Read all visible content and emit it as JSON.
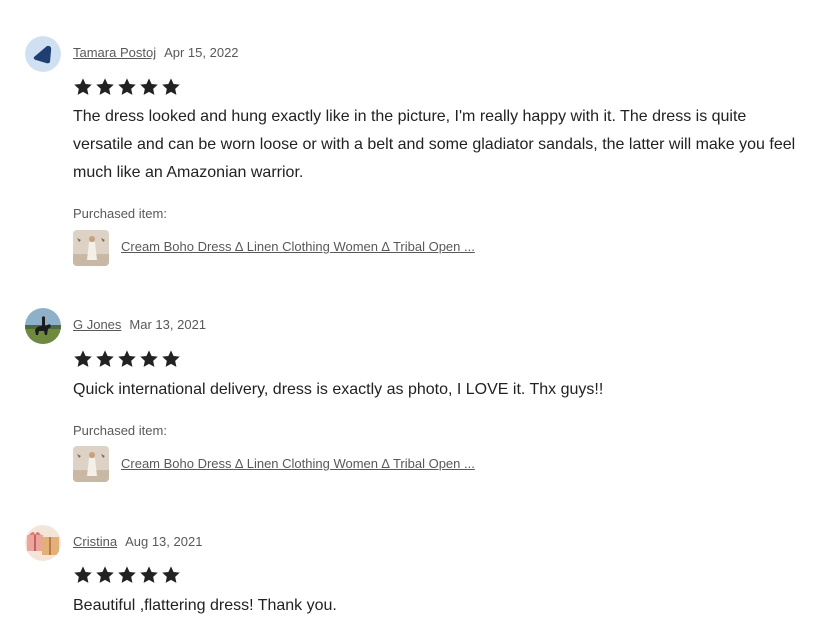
{
  "reviews": [
    {
      "reviewer": "Tamara Postoj",
      "date": "Apr 15, 2022",
      "rating": 5,
      "text": "The dress looked and hung exactly like in the picture, I'm really happy with it. The dress is quite versatile and can be worn loose or with a belt and some gladiator sandals, the latter will make you feel much like an Amazonian warrior.",
      "purchased_label": "Purchased item:",
      "item_title": "Cream Boho Dress ∆ Linen Clothing Women ∆ Tribal Open ...",
      "avatar_icon": "shield-logo-avatar"
    },
    {
      "reviewer": "G Jones",
      "date": "Mar 13, 2021",
      "rating": 5,
      "text": "Quick international delivery, dress is exactly as photo, I LOVE it. Thx guys!!",
      "purchased_label": "Purchased item:",
      "item_title": "Cream Boho Dress ∆ Linen Clothing Women ∆ Tribal Open ...",
      "avatar_icon": "horse-rider-photo-avatar"
    },
    {
      "reviewer": "Cristina",
      "date": "Aug 13, 2021",
      "rating": 5,
      "text": "Beautiful ,flattering dress! Thank you.",
      "avatar_icon": "gift-boxes-photo-avatar"
    }
  ],
  "colors": {
    "text": "#222222",
    "muted": "#595959",
    "star": "#222222"
  }
}
